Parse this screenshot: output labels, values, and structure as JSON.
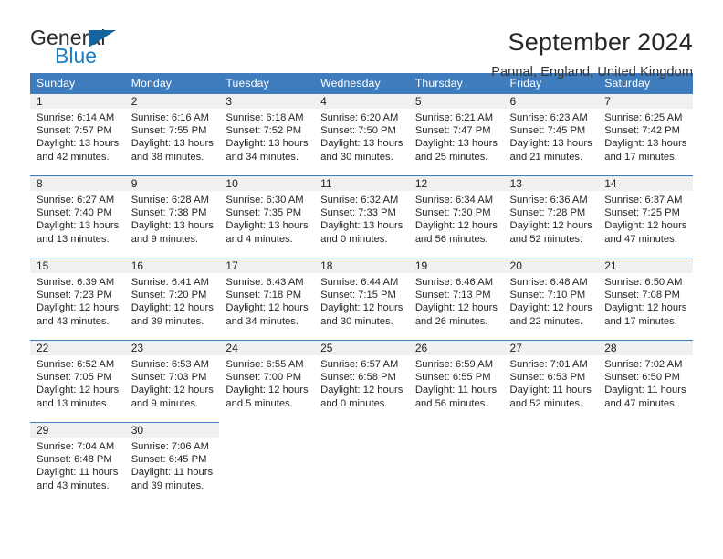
{
  "logo": {
    "primary_text": "General",
    "secondary_text": "Blue",
    "triangle_color": "#14659f",
    "secondary_color": "#1b7dc4",
    "icon": "general-blue-logo"
  },
  "header": {
    "title": "September 2024",
    "subtitle": "Pannal, England, United Kingdom"
  },
  "theme": {
    "header_blue": "#3e7cbd",
    "daynum_bg": "#f0f0f0",
    "text": "#262626"
  },
  "calendar": {
    "weekday_headers": [
      "Sunday",
      "Monday",
      "Tuesday",
      "Wednesday",
      "Thursday",
      "Friday",
      "Saturday"
    ],
    "labels": {
      "sunrise": "Sunrise:",
      "sunset": "Sunset:",
      "daylight": "Daylight:"
    },
    "weeks": [
      [
        {
          "day": "1",
          "sunrise": "Sunrise: 6:14 AM",
          "sunset": "Sunset: 7:57 PM",
          "daylight_line1": "Daylight: 13 hours",
          "daylight_line2": "and 42 minutes."
        },
        {
          "day": "2",
          "sunrise": "Sunrise: 6:16 AM",
          "sunset": "Sunset: 7:55 PM",
          "daylight_line1": "Daylight: 13 hours",
          "daylight_line2": "and 38 minutes."
        },
        {
          "day": "3",
          "sunrise": "Sunrise: 6:18 AM",
          "sunset": "Sunset: 7:52 PM",
          "daylight_line1": "Daylight: 13 hours",
          "daylight_line2": "and 34 minutes."
        },
        {
          "day": "4",
          "sunrise": "Sunrise: 6:20 AM",
          "sunset": "Sunset: 7:50 PM",
          "daylight_line1": "Daylight: 13 hours",
          "daylight_line2": "and 30 minutes."
        },
        {
          "day": "5",
          "sunrise": "Sunrise: 6:21 AM",
          "sunset": "Sunset: 7:47 PM",
          "daylight_line1": "Daylight: 13 hours",
          "daylight_line2": "and 25 minutes."
        },
        {
          "day": "6",
          "sunrise": "Sunrise: 6:23 AM",
          "sunset": "Sunset: 7:45 PM",
          "daylight_line1": "Daylight: 13 hours",
          "daylight_line2": "and 21 minutes."
        },
        {
          "day": "7",
          "sunrise": "Sunrise: 6:25 AM",
          "sunset": "Sunset: 7:42 PM",
          "daylight_line1": "Daylight: 13 hours",
          "daylight_line2": "and 17 minutes."
        }
      ],
      [
        {
          "day": "8",
          "sunrise": "Sunrise: 6:27 AM",
          "sunset": "Sunset: 7:40 PM",
          "daylight_line1": "Daylight: 13 hours",
          "daylight_line2": "and 13 minutes."
        },
        {
          "day": "9",
          "sunrise": "Sunrise: 6:28 AM",
          "sunset": "Sunset: 7:38 PM",
          "daylight_line1": "Daylight: 13 hours",
          "daylight_line2": "and 9 minutes."
        },
        {
          "day": "10",
          "sunrise": "Sunrise: 6:30 AM",
          "sunset": "Sunset: 7:35 PM",
          "daylight_line1": "Daylight: 13 hours",
          "daylight_line2": "and 4 minutes."
        },
        {
          "day": "11",
          "sunrise": "Sunrise: 6:32 AM",
          "sunset": "Sunset: 7:33 PM",
          "daylight_line1": "Daylight: 13 hours",
          "daylight_line2": "and 0 minutes."
        },
        {
          "day": "12",
          "sunrise": "Sunrise: 6:34 AM",
          "sunset": "Sunset: 7:30 PM",
          "daylight_line1": "Daylight: 12 hours",
          "daylight_line2": "and 56 minutes."
        },
        {
          "day": "13",
          "sunrise": "Sunrise: 6:36 AM",
          "sunset": "Sunset: 7:28 PM",
          "daylight_line1": "Daylight: 12 hours",
          "daylight_line2": "and 52 minutes."
        },
        {
          "day": "14",
          "sunrise": "Sunrise: 6:37 AM",
          "sunset": "Sunset: 7:25 PM",
          "daylight_line1": "Daylight: 12 hours",
          "daylight_line2": "and 47 minutes."
        }
      ],
      [
        {
          "day": "15",
          "sunrise": "Sunrise: 6:39 AM",
          "sunset": "Sunset: 7:23 PM",
          "daylight_line1": "Daylight: 12 hours",
          "daylight_line2": "and 43 minutes."
        },
        {
          "day": "16",
          "sunrise": "Sunrise: 6:41 AM",
          "sunset": "Sunset: 7:20 PM",
          "daylight_line1": "Daylight: 12 hours",
          "daylight_line2": "and 39 minutes."
        },
        {
          "day": "17",
          "sunrise": "Sunrise: 6:43 AM",
          "sunset": "Sunset: 7:18 PM",
          "daylight_line1": "Daylight: 12 hours",
          "daylight_line2": "and 34 minutes."
        },
        {
          "day": "18",
          "sunrise": "Sunrise: 6:44 AM",
          "sunset": "Sunset: 7:15 PM",
          "daylight_line1": "Daylight: 12 hours",
          "daylight_line2": "and 30 minutes."
        },
        {
          "day": "19",
          "sunrise": "Sunrise: 6:46 AM",
          "sunset": "Sunset: 7:13 PM",
          "daylight_line1": "Daylight: 12 hours",
          "daylight_line2": "and 26 minutes."
        },
        {
          "day": "20",
          "sunrise": "Sunrise: 6:48 AM",
          "sunset": "Sunset: 7:10 PM",
          "daylight_line1": "Daylight: 12 hours",
          "daylight_line2": "and 22 minutes."
        },
        {
          "day": "21",
          "sunrise": "Sunrise: 6:50 AM",
          "sunset": "Sunset: 7:08 PM",
          "daylight_line1": "Daylight: 12 hours",
          "daylight_line2": "and 17 minutes."
        }
      ],
      [
        {
          "day": "22",
          "sunrise": "Sunrise: 6:52 AM",
          "sunset": "Sunset: 7:05 PM",
          "daylight_line1": "Daylight: 12 hours",
          "daylight_line2": "and 13 minutes."
        },
        {
          "day": "23",
          "sunrise": "Sunrise: 6:53 AM",
          "sunset": "Sunset: 7:03 PM",
          "daylight_line1": "Daylight: 12 hours",
          "daylight_line2": "and 9 minutes."
        },
        {
          "day": "24",
          "sunrise": "Sunrise: 6:55 AM",
          "sunset": "Sunset: 7:00 PM",
          "daylight_line1": "Daylight: 12 hours",
          "daylight_line2": "and 5 minutes."
        },
        {
          "day": "25",
          "sunrise": "Sunrise: 6:57 AM",
          "sunset": "Sunset: 6:58 PM",
          "daylight_line1": "Daylight: 12 hours",
          "daylight_line2": "and 0 minutes."
        },
        {
          "day": "26",
          "sunrise": "Sunrise: 6:59 AM",
          "sunset": "Sunset: 6:55 PM",
          "daylight_line1": "Daylight: 11 hours",
          "daylight_line2": "and 56 minutes."
        },
        {
          "day": "27",
          "sunrise": "Sunrise: 7:01 AM",
          "sunset": "Sunset: 6:53 PM",
          "daylight_line1": "Daylight: 11 hours",
          "daylight_line2": "and 52 minutes."
        },
        {
          "day": "28",
          "sunrise": "Sunrise: 7:02 AM",
          "sunset": "Sunset: 6:50 PM",
          "daylight_line1": "Daylight: 11 hours",
          "daylight_line2": "and 47 minutes."
        }
      ],
      [
        {
          "day": "29",
          "sunrise": "Sunrise: 7:04 AM",
          "sunset": "Sunset: 6:48 PM",
          "daylight_line1": "Daylight: 11 hours",
          "daylight_line2": "and 43 minutes."
        },
        {
          "day": "30",
          "sunrise": "Sunrise: 7:06 AM",
          "sunset": "Sunset: 6:45 PM",
          "daylight_line1": "Daylight: 11 hours",
          "daylight_line2": "and 39 minutes."
        },
        {
          "day": "",
          "sunrise": "",
          "sunset": "",
          "daylight_line1": "",
          "daylight_line2": ""
        },
        {
          "day": "",
          "sunrise": "",
          "sunset": "",
          "daylight_line1": "",
          "daylight_line2": ""
        },
        {
          "day": "",
          "sunrise": "",
          "sunset": "",
          "daylight_line1": "",
          "daylight_line2": ""
        },
        {
          "day": "",
          "sunrise": "",
          "sunset": "",
          "daylight_line1": "",
          "daylight_line2": ""
        },
        {
          "day": "",
          "sunrise": "",
          "sunset": "",
          "daylight_line1": "",
          "daylight_line2": ""
        }
      ]
    ]
  }
}
